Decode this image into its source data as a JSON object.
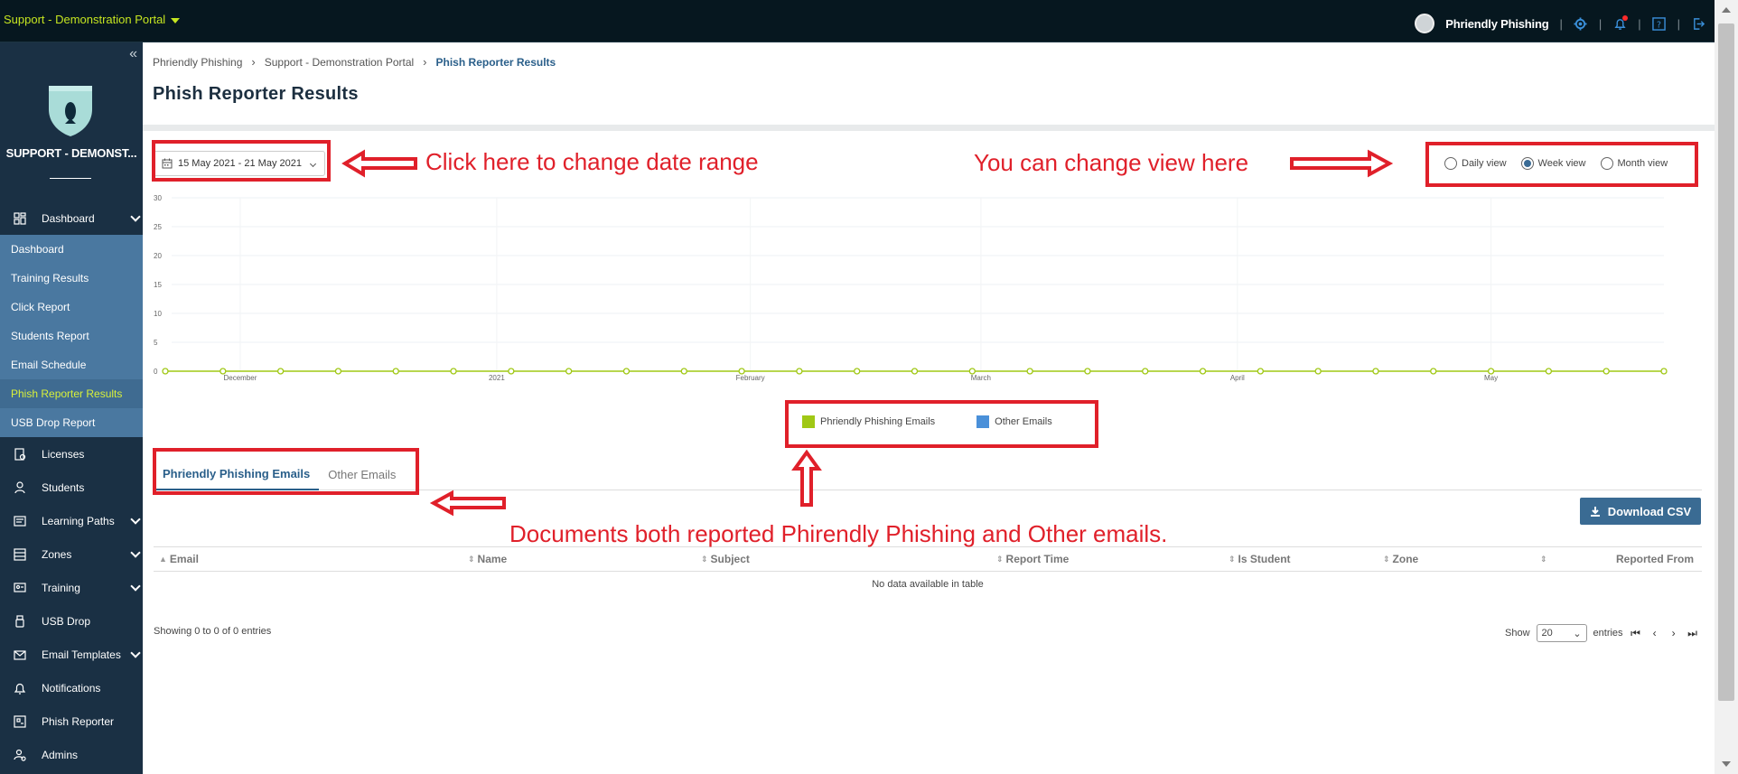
{
  "topbar": {
    "portal_name": "Support - Demonstration Portal",
    "user_name": "Phriendly Phishing",
    "separator": "|"
  },
  "sidebar": {
    "brand": "SUPPORT - DEMONST...",
    "collapse_symbol": "«",
    "items": [
      {
        "label": "Dashboard",
        "icon": "dashboard-icon",
        "expandable": true
      },
      {
        "label": "Licenses",
        "icon": "license-icon",
        "expandable": false
      },
      {
        "label": "Students",
        "icon": "students-icon",
        "expandable": false
      },
      {
        "label": "Learning Paths",
        "icon": "learning-paths-icon",
        "expandable": true
      },
      {
        "label": "Zones",
        "icon": "zones-icon",
        "expandable": true
      },
      {
        "label": "Training",
        "icon": "training-icon",
        "expandable": true
      },
      {
        "label": "USB Drop",
        "icon": "usb-icon",
        "expandable": false
      },
      {
        "label": "Email Templates",
        "icon": "email-templates-icon",
        "expandable": true
      },
      {
        "label": "Notifications",
        "icon": "bell-icon",
        "expandable": false
      },
      {
        "label": "Phish Reporter",
        "icon": "phish-reporter-icon",
        "expandable": false
      },
      {
        "label": "Admins",
        "icon": "admins-icon",
        "expandable": false
      }
    ],
    "dashboard_sub": [
      {
        "label": "Dashboard",
        "active": false
      },
      {
        "label": "Training Results",
        "active": false
      },
      {
        "label": "Click Report",
        "active": false
      },
      {
        "label": "Students Report",
        "active": false
      },
      {
        "label": "Email Schedule",
        "active": false
      },
      {
        "label": "Phish Reporter Results",
        "active": true
      },
      {
        "label": "USB Drop Report",
        "active": false
      }
    ]
  },
  "breadcrumb": [
    "Phriendly Phishing",
    "Support - Demonstration Portal",
    "Phish Reporter Results"
  ],
  "breadcrumb_sep": "›",
  "page_title": "Phish Reporter Results",
  "date_range": "15 May 2021 - 21 May 2021",
  "views": [
    {
      "label": "Daily view",
      "selected": false
    },
    {
      "label": "Week view",
      "selected": true
    },
    {
      "label": "Month view",
      "selected": false
    }
  ],
  "chart_data": {
    "type": "line",
    "ylim": [
      0,
      30
    ],
    "y_ticks": [
      0,
      5,
      10,
      15,
      20,
      25,
      30
    ],
    "x_tick_labels": [
      "December",
      "2021",
      "February",
      "March",
      "April",
      "May"
    ],
    "series": [
      {
        "name": "Phriendly Phishing Emails",
        "color": "#a0c815",
        "values": [
          0,
          0,
          0,
          0,
          0,
          0,
          0,
          0,
          0,
          0,
          0,
          0,
          0,
          0,
          0,
          0,
          0,
          0,
          0,
          0,
          0,
          0,
          0,
          0,
          0,
          0,
          0
        ]
      },
      {
        "name": "Other Emails",
        "color": "#4a90d9",
        "values": []
      }
    ],
    "grid": true
  },
  "tabs": [
    {
      "label": "Phriendly Phishing Emails",
      "active": true
    },
    {
      "label": "Other Emails",
      "active": false
    }
  ],
  "download_label": "Download CSV",
  "table": {
    "columns": [
      "Email",
      "Name",
      "Subject",
      "Report Time",
      "Is Student",
      "Zone",
      "",
      "Reported From"
    ],
    "empty_message": "No data available in table"
  },
  "table_info": "Showing 0 to 0 of 0 entries",
  "pager": {
    "show_label": "Show",
    "page_size": "20",
    "entries_label": "entries"
  },
  "annotations": {
    "date": "Click here to change date range",
    "view": "You can change view here",
    "docs": "Documents both reported Phirendly Phishing and Other emails."
  },
  "colors": {
    "accent": "#2a5f8a",
    "annotation": "#e0202a",
    "portal_link": "#c5e520"
  }
}
